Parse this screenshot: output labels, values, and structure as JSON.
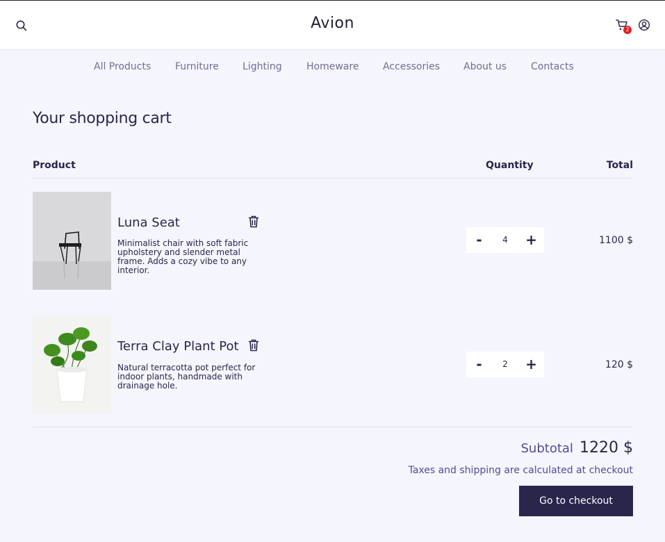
{
  "header": {
    "brand": "Avion",
    "cart_count": "2",
    "icons": {
      "search": "search-icon",
      "cart": "cart-icon",
      "user": "user-icon"
    }
  },
  "nav": {
    "items": [
      "All Products",
      "Furniture",
      "Lighting",
      "Homeware",
      "Accessories",
      "About us",
      "Contacts"
    ]
  },
  "cart": {
    "title": "Your shopping cart",
    "columns": {
      "product": "Product",
      "quantity": "Quantity",
      "total": "Total"
    },
    "items": [
      {
        "name": "Luna Seat",
        "description": "Minimalist chair with soft fabric upholstery and slender metal frame. Adds a cozy vibe to any interior.",
        "quantity": "4",
        "total": "1100 $",
        "minus": "-",
        "plus": "+"
      },
      {
        "name": "Terra Clay Plant Pot",
        "description": "Natural terracotta pot perfect for indoor plants, handmade with drainage hole.",
        "quantity": "2",
        "total": "120 $",
        "minus": "-",
        "plus": "+"
      }
    ],
    "subtotal_label": "Subtotal",
    "subtotal_value": "1220 $",
    "tax_note": "Taxes and shipping are calculated at checkout",
    "checkout_label": "Go to checkout"
  },
  "colors": {
    "primary": "#2a254b",
    "page_bg": "#f5f5fd",
    "muted": "#4e4d93",
    "badge": "#e02020"
  }
}
